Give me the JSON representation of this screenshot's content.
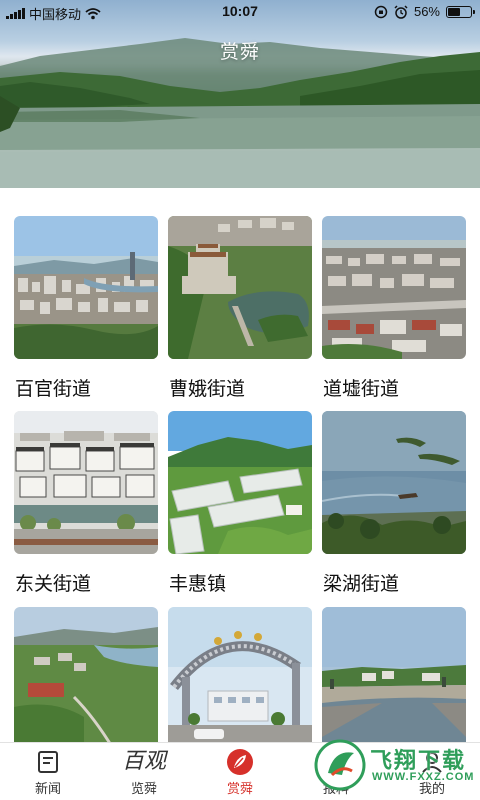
{
  "status_bar": {
    "carrier": "中国移动",
    "time": "10:07",
    "battery_percent": "56%",
    "battery_level": 0.56,
    "icons": [
      "signal-icon",
      "wifi-icon",
      "lock-rotation-icon",
      "alarm-icon",
      "battery-icon"
    ]
  },
  "header": {
    "title": "赏舜"
  },
  "places": [
    {
      "label": "百官街道",
      "image": "city-skyline-aerial"
    },
    {
      "label": "曹娥街道",
      "image": "temple-lake-aerial"
    },
    {
      "label": "道墟街道",
      "image": "town-aerial"
    },
    {
      "label": "东关街道",
      "image": "white-houses-aerial"
    },
    {
      "label": "丰惠镇",
      "image": "greenhouse-fields"
    },
    {
      "label": "梁湖街道",
      "image": "lake-islands"
    },
    {
      "label": "",
      "image": "riverside-fields-aerial"
    },
    {
      "label": "",
      "image": "gateway-arch"
    },
    {
      "label": "",
      "image": "canal-village"
    }
  ],
  "tabs": [
    {
      "label": "新闻",
      "icon": "news-icon",
      "active": false
    },
    {
      "label": "览舜",
      "icon": "calligraphy-logo-icon",
      "active": false,
      "icon_text": "百观"
    },
    {
      "label": "赏舜",
      "icon": "leaf-badge-icon",
      "active": true
    },
    {
      "label": "报料",
      "icon": "report-icon",
      "active": false
    },
    {
      "label": "我的",
      "icon": "profile-icon",
      "active": false
    }
  ],
  "watermark": {
    "title": "飞翔下载",
    "url": "WWW.FXXZ.COM"
  },
  "colors": {
    "accent": "#d6302a",
    "tab_text": "#333333",
    "label_text": "#111111"
  }
}
